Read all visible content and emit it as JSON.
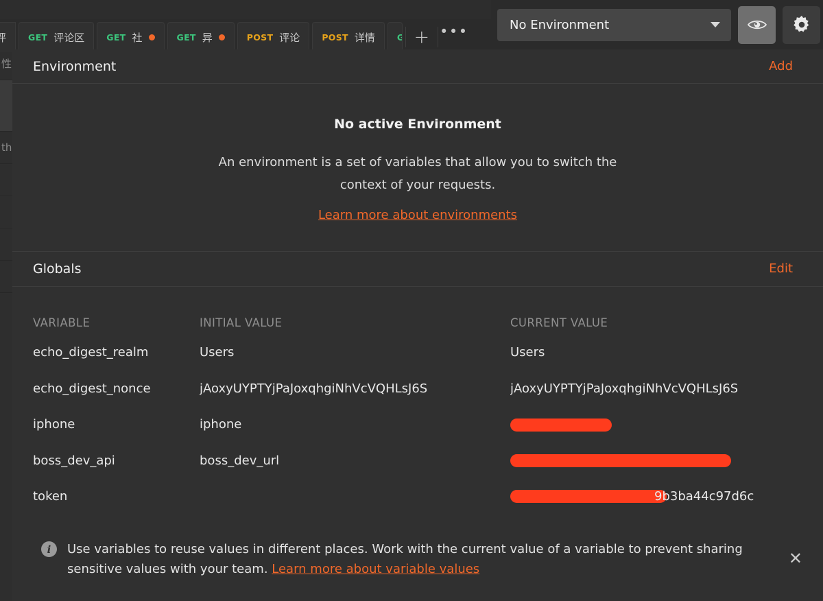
{
  "tabs": [
    {
      "method": "",
      "name": "评",
      "dot": false,
      "clipped": true
    },
    {
      "method": "GET",
      "name": "评论区",
      "dot": false,
      "clipped": false
    },
    {
      "method": "GET",
      "name": "社",
      "dot": true,
      "clipped": false
    },
    {
      "method": "GET",
      "name": "异",
      "dot": true,
      "clipped": false
    },
    {
      "method": "POST",
      "name": "评论",
      "dot": false,
      "clipped": false
    },
    {
      "method": "POST",
      "name": "详情",
      "dot": false,
      "clipped": false
    },
    {
      "method": "G",
      "name": "",
      "dot": false,
      "clipped": false
    }
  ],
  "tabbar": {
    "add_label": "+",
    "more_label": "•••"
  },
  "env_selector": {
    "value": "No Environment",
    "caret": "chevron-down-icon",
    "eye_icon": "eye-icon",
    "gear_icon": "gear-icon"
  },
  "environment": {
    "title": "Environment",
    "add_label": "Add",
    "empty_title": "No active Environment",
    "empty_desc": "An environment is a set of variables that allow you to switch the context of your requests.",
    "empty_link": "Learn more about environments"
  },
  "globals": {
    "title": "Globals",
    "edit_label": "Edit",
    "columns": [
      "VARIABLE",
      "INITIAL VALUE",
      "CURRENT VALUE"
    ],
    "rows": [
      {
        "variable": "echo_digest_realm",
        "initial": "Users",
        "current": "Users",
        "current_redacted": false
      },
      {
        "variable": "echo_digest_nonce",
        "initial": "jAoxyUYPTYjPaJoxqhgiNhVcVQHLsJ6S",
        "current": "jAoxyUYPTYjPaJoxqhgiNhVcVQHLsJ6S",
        "current_redacted": false
      },
      {
        "variable": "iphone",
        "initial": "iphone",
        "current": "",
        "current_redacted": true,
        "redact_width": 148
      },
      {
        "variable": "boss_dev_api",
        "initial": "boss_dev_url",
        "current": "",
        "current_redacted": true,
        "redact_width": 322
      },
      {
        "variable": "token",
        "initial": "",
        "current": "9b3ba44c97d6c",
        "current_redacted": true,
        "redact_width": 228
      }
    ]
  },
  "footer": {
    "info_icon": "info-icon",
    "text_before": "Use variables to reuse values in different places. Work with the current value of a variable to prevent sharing sensitive values with your team. ",
    "link": "Learn more about variable values",
    "close_label": "✕"
  },
  "colors": {
    "accent": "#f2682a",
    "get": "#3cc47c",
    "post": "#e6a21b",
    "redaction": "#ff3c1d",
    "modal_bg": "#303030",
    "app_bg": "#2b2b2b"
  }
}
